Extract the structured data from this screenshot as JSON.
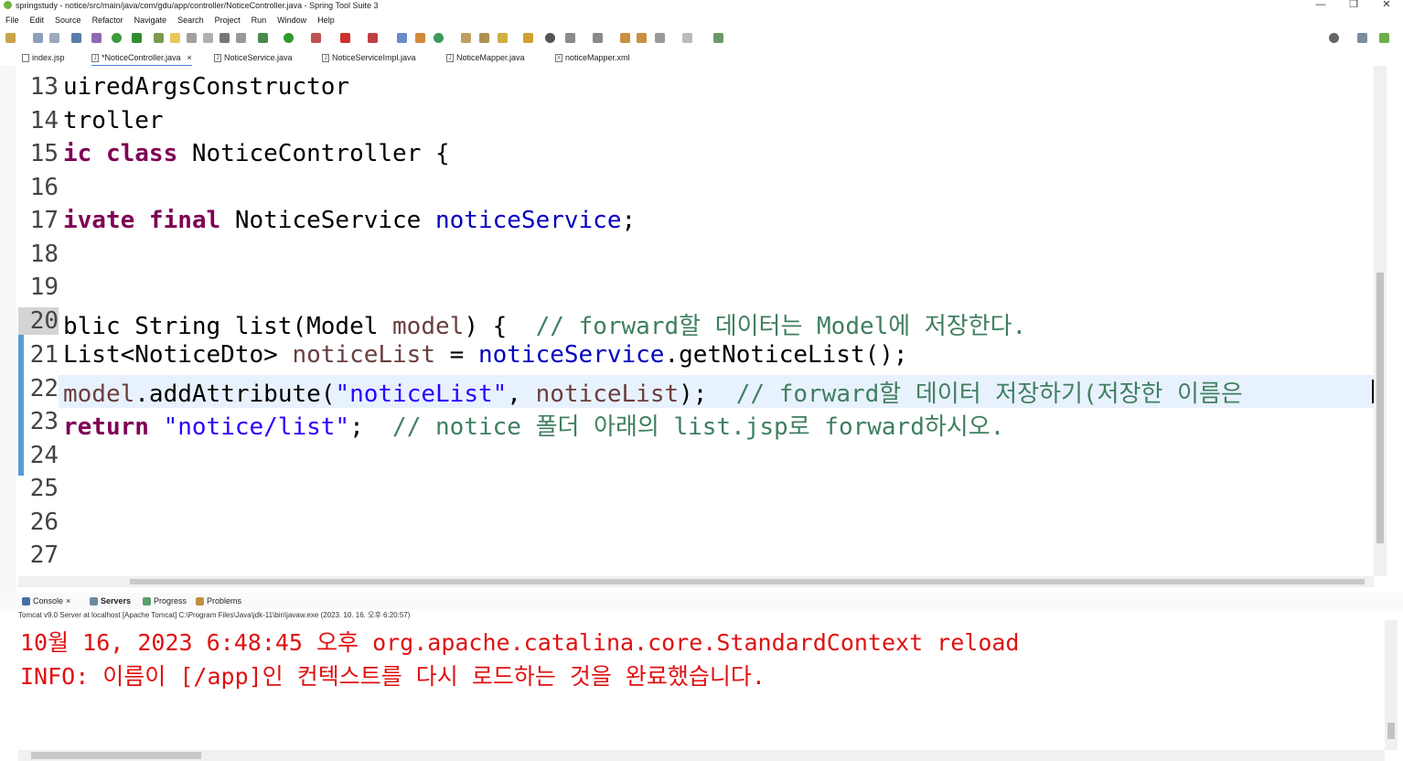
{
  "window": {
    "title": "springstudy - notice/src/main/java/com/gdu/app/controller/NoticeController.java - Spring Tool Suite 3",
    "controls": {
      "minimize": "—",
      "restore": "❐",
      "close": "✕"
    }
  },
  "menu": [
    "File",
    "Edit",
    "Source",
    "Refactor",
    "Navigate",
    "Search",
    "Project",
    "Run",
    "Window",
    "Help"
  ],
  "tabs": [
    {
      "label": "index.jsp",
      "icon": "jsp-file-icon"
    },
    {
      "label": "*NoticeController.java",
      "icon": "java-file-icon",
      "active": true,
      "close": "×"
    },
    {
      "label": "NoticeService.java",
      "icon": "java-file-icon"
    },
    {
      "label": "NoticeServiceImpl.java",
      "icon": "java-file-icon"
    },
    {
      "label": "NoticeMapper.java",
      "icon": "java-file-icon"
    },
    {
      "label": "noticeMapper.xml",
      "icon": "xml-file-icon"
    }
  ],
  "editor": {
    "lines": [
      {
        "n": "13",
        "text": "uiredArgsConstructor"
      },
      {
        "n": "14",
        "text": "troller"
      },
      {
        "n": "15",
        "t1": "ic class",
        "t2": " NoticeController {"
      },
      {
        "n": "16"
      },
      {
        "n": "17",
        "t1": "ivate final",
        "t2": " NoticeService ",
        "t3": "noticeService",
        "t4": ";"
      },
      {
        "n": "18"
      },
      {
        "n": "19"
      },
      {
        "n": "20",
        "t1": "blic String list(Model ",
        "t2": "model",
        "t3": ") {  ",
        "t4": "// forward할 데이터는 Model에 저장한다."
      },
      {
        "n": "21",
        "t1": "List<NoticeDto> ",
        "t2": "noticeList",
        "t3": " = ",
        "t4": "noticeService",
        "t5": ".getNoticeList();"
      },
      {
        "n": "22",
        "t1": "model",
        "t2": ".addAttribute(",
        "t3": "\"noticeList\"",
        "t4": ", ",
        "t5": "noticeList",
        "t6": ");  ",
        "t7": "// forward할 데이터 저장하기(저장한 이름은"
      },
      {
        "n": "23",
        "t1": "return",
        "t2": " ",
        "t3": "\"notice/list\"",
        "t4": ";  ",
        "t5": "// notice 폴더 아래의 list.jsp로 forward하시오."
      },
      {
        "n": "24"
      },
      {
        "n": "25"
      },
      {
        "n": "26"
      },
      {
        "n": "27"
      }
    ]
  },
  "bottom_panel": {
    "tabs": [
      {
        "label": "Console",
        "icon": "console-icon",
        "close": "×"
      },
      {
        "label": "Servers",
        "icon": "servers-icon"
      },
      {
        "label": "Progress",
        "icon": "progress-icon"
      },
      {
        "label": "Problems",
        "icon": "problems-icon"
      }
    ],
    "status": "Tomcat v9.0 Server at localhost [Apache Tomcat] C:\\Program Files\\Java\\jdk-11\\bin\\javaw.exe  (2023. 10. 16. 오후 6:20:57)",
    "output": [
      "10월 16, 2023 6:48:45 오후 org.apache.catalina.core.StandardContext reload",
      "INFO: 이름이 [/app]인 컨텍스트를 다시 로드하는 것을 완료했습니다."
    ]
  },
  "colors": {
    "keyword": "#7f0055",
    "field": "#0000c0",
    "string": "#2a00ff",
    "comment": "#3f7f5f",
    "console_text": "#e01010",
    "current_line": "#e8f2fe"
  }
}
